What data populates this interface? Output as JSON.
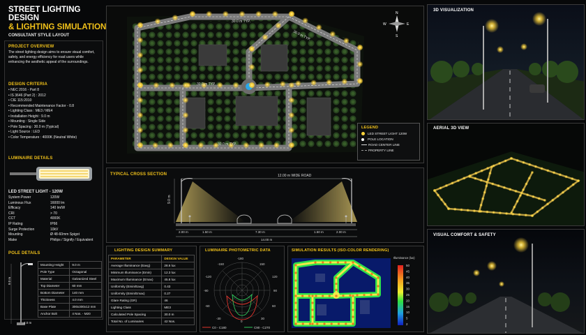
{
  "title": {
    "line1": "STREET LIGHTING DESIGN",
    "line2": "& LIGHTING SIMULATION",
    "subtitle": "CONSULTANT STYLE LAYOUT"
  },
  "overview": {
    "heading": "PROJECT OVERVIEW",
    "text": "The street lighting design aims to ensure visual comfort, safety, and energy efficiency for road users while enhancing the aesthetic appeal of the surroundings."
  },
  "criteria": {
    "heading": "DESIGN CRITERIA",
    "items": [
      "NEC 2016 - Part 8",
      "IS 3646 (Part 2) : 2012",
      "CIE 115:2010",
      "Recommended Maintenance Factor - 0.8",
      "Lighting Class       : ME3 / ME4",
      "Installation Height : 9.0 m",
      "Mounting            : Single Side",
      "Pole Spacing       : 30.0 m (Typical)",
      "Light Source       : LED",
      "Color Temperature  : 4000K (Neutral White)"
    ]
  },
  "luminaire": {
    "heading": "LUMINAIRE DETAILS",
    "name": "LED STREET LIGHT - 120W",
    "specs": [
      [
        "System Power",
        "120W"
      ],
      [
        "Luminous Flux",
        "16000 lm"
      ],
      [
        "Efficacy",
        "140 lm/W"
      ],
      [
        "CRI",
        "> 70"
      ],
      [
        "CCT",
        "4000K"
      ],
      [
        "IP Rating",
        "IP66"
      ],
      [
        "Surge Protection",
        "10kV"
      ],
      [
        "Mounting",
        "Ø 48-60mm Spigot"
      ],
      [
        "Make",
        "Philips / Signify / Equivalent"
      ]
    ]
  },
  "pole": {
    "heading": "POLE DETAILS",
    "height_label": "9.0 m",
    "base_label": "2.0 m",
    "rows": [
      [
        "Mounting Height",
        "9.0 m"
      ],
      [
        "Pole Type",
        "Octagonal"
      ],
      [
        "Material",
        "Galvanized Steel"
      ],
      [
        "Top Diameter",
        "60 mm"
      ],
      [
        "Bottom Diameter",
        "140 mm"
      ],
      [
        "Thickness",
        "4.0 mm"
      ],
      [
        "Base Plate",
        "300x300x12 mm"
      ],
      [
        "Anchor Bolt",
        "4 Nos. - M20"
      ]
    ]
  },
  "plan": {
    "road_labels": [
      "30.0 m TYP.",
      "30.0 m TYP.",
      "30.0 m TYP.",
      "30.0 m TYP."
    ],
    "compass": {
      "n": "N",
      "s": "S",
      "e": "E",
      "w": "W"
    }
  },
  "legend": {
    "heading": "LEGEND",
    "items": [
      "LED STREET LIGHT 120W",
      "POLE LOCATION",
      "ROAD CENTER LINE",
      "PROPERTY LINE"
    ]
  },
  "cross_section": {
    "heading": "TYPICAL CROSS SECTION",
    "road_width": "12.00 m WIDE ROAD",
    "height": "9.0 m",
    "dims": [
      "2.00 m",
      "1.50 m",
      "7.30 m",
      "1.50 m",
      "2.00 m"
    ],
    "total": "14.00 m"
  },
  "summary": {
    "heading": "LIGHTING DESIGN SUMMARY",
    "col1": "PARAMETER",
    "col2": "DESIGN VALUE",
    "rows": [
      [
        "Average Illuminance (Eavg)",
        "28.6 lux"
      ],
      [
        "Minimum Illuminance (Emin)",
        "12.3 lux"
      ],
      [
        "Maximum Illuminance (Emax)",
        "45.8 lux"
      ],
      [
        "Uniformity (Emin/Eavg)",
        "0.43"
      ],
      [
        "Uniformity (Emin/Emax)",
        "0.27"
      ],
      [
        "Glare Rating (GR)",
        "46"
      ],
      [
        "Lighting Class",
        "ME3"
      ],
      [
        "Calculated Pole Spacing",
        "30.0 m"
      ],
      [
        "Total No. of Luminaires",
        "42 Nos."
      ]
    ]
  },
  "photometric": {
    "heading": "LUMINAIRE PHOTOMETRIC DATA",
    "angles": [
      "-150",
      "-180",
      "150",
      "-120",
      "120",
      "-90",
      "90",
      "-60",
      "60",
      "-30",
      "0",
      "30"
    ],
    "legend1": "C0 - C180",
    "legend2": "C90 - C270",
    "color1": "#e0332b",
    "color2": "#2fc85a"
  },
  "simulation": {
    "heading": "SIMULATION RESULTS (ISO-COLOR RENDERING)",
    "scale_title": "Illuminance (lux)",
    "scale_values": [
      "50",
      "45",
      "40",
      "35",
      "30",
      "25",
      "20",
      "15",
      "10",
      "5",
      "2"
    ]
  },
  "views": {
    "v1": "3D VISUALIZATION",
    "v2": "AERIAL 3D VIEW",
    "v3": "VISUAL COMFORT & SAFETY"
  }
}
